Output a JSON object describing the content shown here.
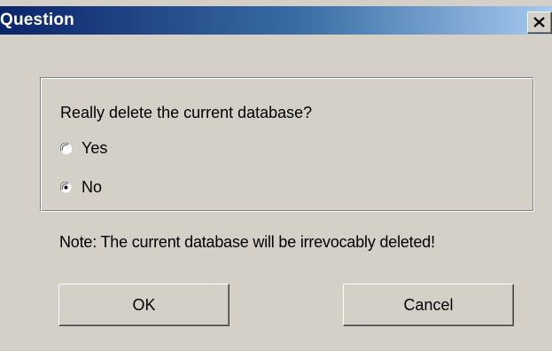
{
  "window": {
    "title": "Question",
    "close_icon": "close-x-icon"
  },
  "group": {
    "question": "Really delete the current database?",
    "options": [
      {
        "label": "Yes",
        "selected": false
      },
      {
        "label": "No",
        "selected": true
      }
    ]
  },
  "note": "Note: The current database will be irrevocably deleted!",
  "buttons": {
    "ok_label": "OK",
    "cancel_label": "Cancel"
  },
  "colors": {
    "title_gradient_start": "#0a246a",
    "title_gradient_end": "#a6caf0",
    "face": "#d4d0c8"
  }
}
